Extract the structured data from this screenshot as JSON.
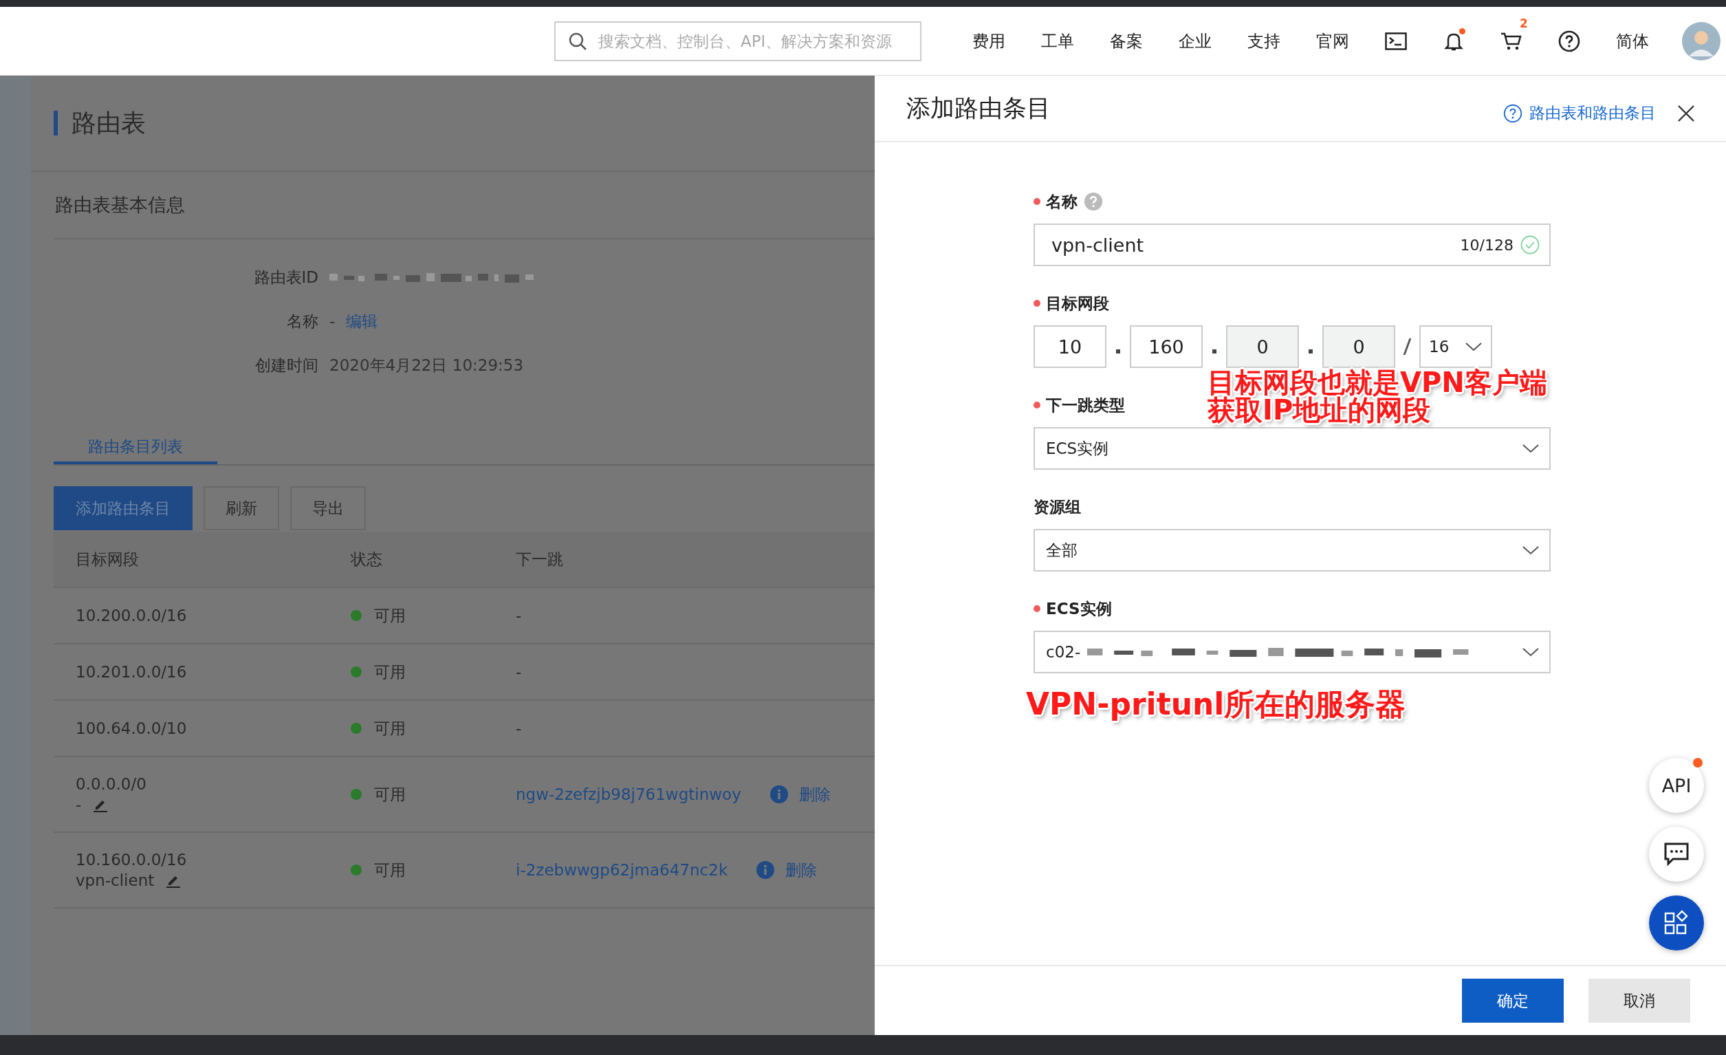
{
  "header": {
    "search_placeholder": "搜索文档、控制台、API、解决方案和资源",
    "nav": [
      "费用",
      "工单",
      "备案",
      "企业",
      "支持",
      "官网"
    ],
    "icons": [
      {
        "kind": "terminal"
      },
      {
        "kind": "bell",
        "unread": true
      },
      {
        "kind": "cart",
        "badge": "2"
      },
      {
        "kind": "help"
      }
    ],
    "language": "简体"
  },
  "page": {
    "title": "路由表",
    "section_title": "路由表基本信息",
    "id_field": {
      "label": "路由表ID"
    },
    "info": [
      {
        "label": "名称",
        "kind": "editable",
        "value": "-",
        "link": "编辑"
      },
      {
        "label": "创建时间",
        "kind": "text",
        "value": "2020年4月22日 10:29:53"
      }
    ],
    "tabs": [
      {
        "label": "路由条目列表",
        "selected": true
      }
    ],
    "buttons": [
      {
        "label": "添加路由条目",
        "primary": true
      },
      {
        "label": "刷新",
        "primary": false
      },
      {
        "label": "导出",
        "primary": false
      }
    ],
    "table": {
      "columns": [
        "目标网段",
        "状态",
        "下一跳"
      ],
      "rows": [
        {
          "cidr": "10.200.0.0/16",
          "status": "可用",
          "next_hop": "-"
        },
        {
          "cidr": "10.201.0.0/16",
          "status": "可用",
          "next_hop": "-"
        },
        {
          "cidr": "100.64.0.0/10",
          "status": "可用",
          "next_hop": "-"
        },
        {
          "cidr": "0.0.0.0/0",
          "name": "-",
          "status": "可用",
          "next_hop_link": "ngw-2zefzjb98j761wgtinwoy",
          "action": "删除"
        },
        {
          "cidr": "10.160.0.0/16",
          "name": "vpn-client",
          "status": "可用",
          "next_hop_link": "i-2zebwwgp62jma647nc2k",
          "action": "删除"
        }
      ]
    }
  },
  "drawer": {
    "title": "添加路由条目",
    "help_link": "路由表和路由条目",
    "fields": [
      {
        "kind": "text",
        "label": "名称",
        "required": true,
        "help": true,
        "value": "vpn-client",
        "counter": "10/128",
        "valid": true
      },
      {
        "kind": "ip",
        "label": "目标网段",
        "required": true,
        "octets": [
          {
            "value": "10",
            "disabled": false
          },
          {
            "value": "160",
            "disabled": false
          },
          {
            "value": "0",
            "disabled": true
          },
          {
            "value": "0",
            "disabled": true
          }
        ],
        "mask": "16"
      },
      {
        "kind": "select",
        "label": "下一跳类型",
        "required": true,
        "value": "ECS实例"
      },
      {
        "kind": "select",
        "label": "资源组",
        "required": false,
        "value": "全部"
      },
      {
        "kind": "select",
        "label": "ECS实例",
        "required": true,
        "value": "c02-",
        "redacted": true
      }
    ],
    "annotations": [
      {
        "lines": [
          "目标网段也就是VPN客户端",
          "获取IP地址的网段"
        ]
      },
      {
        "lines": [
          "VPN-pritunl所在的服务器"
        ]
      }
    ],
    "buttons": [
      {
        "label": "确定",
        "primary": true
      },
      {
        "label": "取消",
        "primary": false
      }
    ]
  },
  "float_buttons": [
    {
      "kind": "api",
      "label": "API",
      "unread": true
    },
    {
      "kind": "chat"
    },
    {
      "kind": "apps"
    }
  ]
}
